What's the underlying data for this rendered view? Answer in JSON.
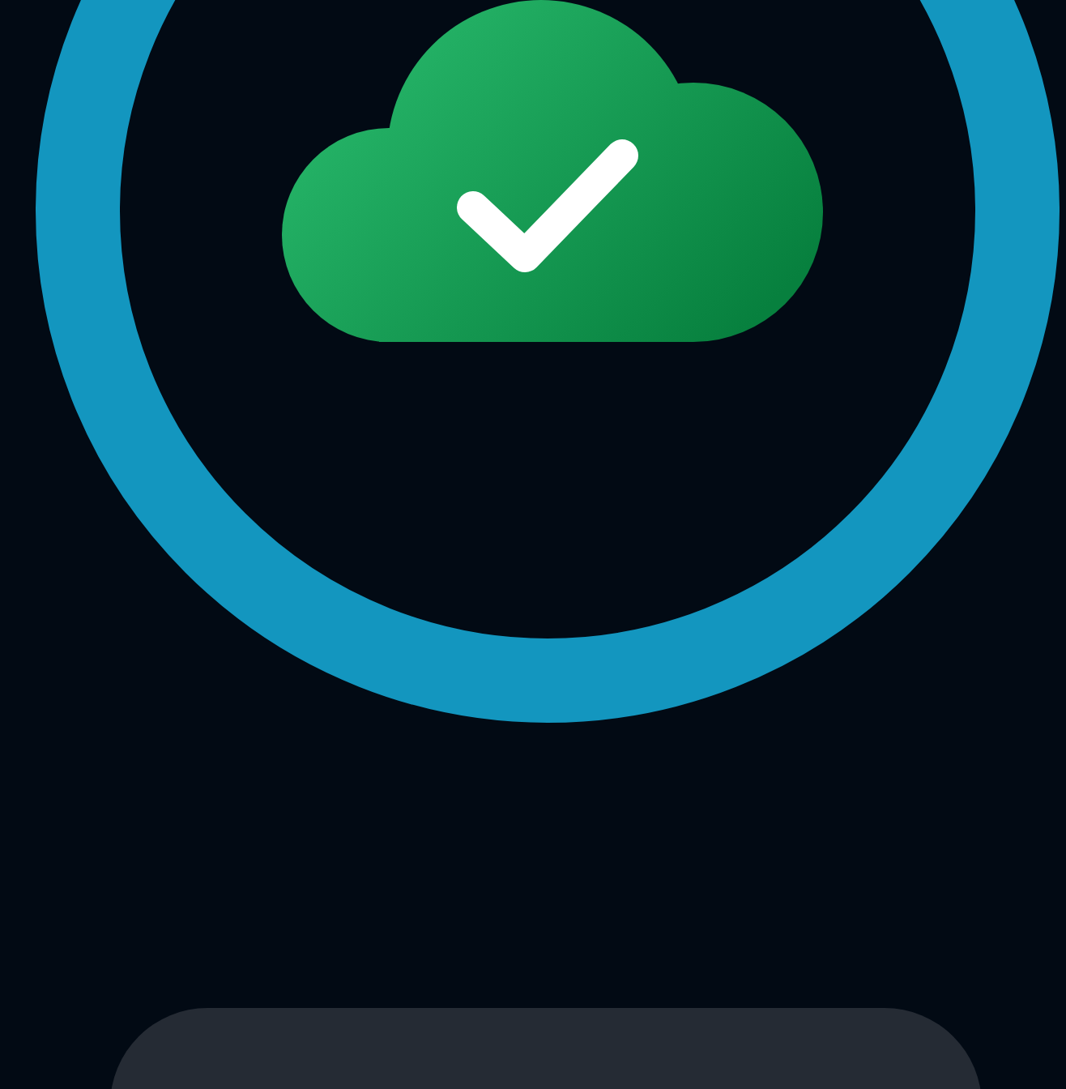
{
  "status": {
    "kind": "synced"
  },
  "bottom_panel": {
    "visible": true
  }
}
